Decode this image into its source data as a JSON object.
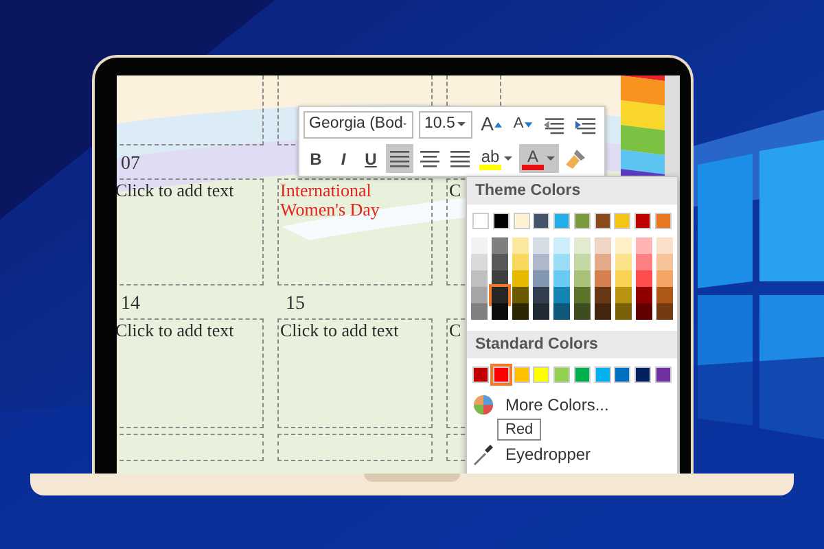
{
  "calendar": {
    "weeks": [
      {
        "days": [
          {
            "number": "07",
            "text": "Click to add text",
            "color": "#2b2b2b"
          },
          {
            "text": "International Women's Day",
            "color": "#e3241d"
          },
          {
            "text": "C",
            "color": "#2b2b2b"
          }
        ]
      },
      {
        "days": [
          {
            "number": "14",
            "text": "Click to add text",
            "color": "#2b2b2b"
          },
          {
            "number": "15",
            "text": "Click to add text",
            "color": "#2b2b2b"
          },
          {
            "text": "C",
            "color": "#2b2b2b"
          }
        ]
      }
    ]
  },
  "mini_toolbar": {
    "font": "Georgia (Bod",
    "size": "10.5",
    "row_1": [
      {
        "kind": "grow",
        "label": "A",
        "selected": false
      },
      {
        "kind": "shrink",
        "label": "A",
        "selected": false
      },
      {
        "kind": "outdent",
        "selected": false
      },
      {
        "kind": "indent",
        "selected": false
      }
    ],
    "row_2": [
      {
        "kind": "bold",
        "label": "B",
        "selected": false
      },
      {
        "kind": "italic",
        "label": "I",
        "selected": false
      },
      {
        "kind": "underline",
        "label": "U",
        "selected": false
      },
      {
        "kind": "align_left",
        "selected": true
      },
      {
        "kind": "align_center",
        "selected": false
      },
      {
        "kind": "align_right",
        "selected": false
      },
      {
        "kind": "highlight",
        "label": "ab",
        "color": "#ffff00",
        "selected": false
      },
      {
        "kind": "font_color",
        "label": "A",
        "color": "#e81010",
        "selected": true
      },
      {
        "kind": "painter",
        "selected": false
      }
    ]
  },
  "color_menu": {
    "theme_title": "Theme Colors",
    "theme_colors": [
      {
        "color": "#ffffff",
        "selected": false
      },
      {
        "color": "#000000",
        "selected": false
      },
      {
        "color": "#fdf3d3",
        "selected": false
      },
      {
        "color": "#44546a",
        "selected": false
      },
      {
        "color": "#22aee6",
        "selected": false
      },
      {
        "color": "#7a9a3a",
        "selected": false
      },
      {
        "color": "#8b4a1a",
        "selected": false
      },
      {
        "color": "#f5c518",
        "selected": false
      },
      {
        "color": "#c00000",
        "selected": false
      },
      {
        "color": "#e87722",
        "selected": false
      }
    ],
    "shades": [
      [
        {
          "color": "#f2f2f2",
          "selected": false
        },
        {
          "color": "#d9d9d9",
          "selected": false
        },
        {
          "color": "#bfbfbf",
          "selected": false
        },
        {
          "color": "#a6a6a6",
          "selected": false
        },
        {
          "color": "#808080",
          "selected": false
        }
      ],
      [
        {
          "color": "#7f7f7f",
          "selected": false
        },
        {
          "color": "#595959",
          "selected": false
        },
        {
          "color": "#3f3f3f",
          "selected": false
        },
        {
          "color": "#262626",
          "selected": true
        },
        {
          "color": "#0d0d0d",
          "selected": false
        }
      ],
      [
        {
          "color": "#fce9a0",
          "selected": false
        },
        {
          "color": "#f9d85f",
          "selected": false
        },
        {
          "color": "#e6b800",
          "selected": false
        },
        {
          "color": "#6b5a00",
          "selected": false
        },
        {
          "color": "#2e2600",
          "selected": false
        }
      ],
      [
        {
          "color": "#d6dce4",
          "selected": false
        },
        {
          "color": "#adb9ca",
          "selected": false
        },
        {
          "color": "#8497b0",
          "selected": false
        },
        {
          "color": "#333f50",
          "selected": false
        },
        {
          "color": "#222a35",
          "selected": false
        }
      ],
      [
        {
          "color": "#cdeefb",
          "selected": false
        },
        {
          "color": "#9bdcf7",
          "selected": false
        },
        {
          "color": "#69cbf3",
          "selected": false
        },
        {
          "color": "#1585b5",
          "selected": false
        },
        {
          "color": "#0e5879",
          "selected": false
        }
      ],
      [
        {
          "color": "#e2ebd2",
          "selected": false
        },
        {
          "color": "#c5d7a5",
          "selected": false
        },
        {
          "color": "#a8c379",
          "selected": false
        },
        {
          "color": "#5c732b",
          "selected": false
        },
        {
          "color": "#3d4d1d",
          "selected": false
        }
      ],
      [
        {
          "color": "#f1d5c4",
          "selected": false
        },
        {
          "color": "#e3ab8a",
          "selected": false
        },
        {
          "color": "#d5814f",
          "selected": false
        },
        {
          "color": "#683714",
          "selected": false
        },
        {
          "color": "#45250d",
          "selected": false
        }
      ],
      [
        {
          "color": "#fdf0c5",
          "selected": false
        },
        {
          "color": "#fbe28b",
          "selected": false
        },
        {
          "color": "#f9d351",
          "selected": false
        },
        {
          "color": "#b8930f",
          "selected": false
        },
        {
          "color": "#7b620a",
          "selected": false
        }
      ],
      [
        {
          "color": "#ffb3b3",
          "selected": false
        },
        {
          "color": "#ff8080",
          "selected": false
        },
        {
          "color": "#ff4d4d",
          "selected": false
        },
        {
          "color": "#900000",
          "selected": false
        },
        {
          "color": "#600000",
          "selected": false
        }
      ],
      [
        {
          "color": "#fbe1cc",
          "selected": false
        },
        {
          "color": "#f7c399",
          "selected": false
        },
        {
          "color": "#f3a566",
          "selected": false
        },
        {
          "color": "#ad5819",
          "selected": false
        },
        {
          "color": "#733b11",
          "selected": false
        }
      ]
    ],
    "standard_title": "Standard Colors",
    "standard_colors": [
      {
        "color": "#c00000",
        "selected": false
      },
      {
        "color": "#ff0000",
        "selected": true
      },
      {
        "color": "#ffc000",
        "selected": false
      },
      {
        "color": "#ffff00",
        "selected": false
      },
      {
        "color": "#92d050",
        "selected": false
      },
      {
        "color": "#00b050",
        "selected": false
      },
      {
        "color": "#00b0f0",
        "selected": false
      },
      {
        "color": "#0070c0",
        "selected": false
      },
      {
        "color": "#002060",
        "selected": false
      },
      {
        "color": "#7030a0",
        "selected": false
      }
    ],
    "items": [
      {
        "kind": "more",
        "label": "More Colors..."
      },
      {
        "kind": "eyedropper",
        "label": "Eyedropper"
      }
    ],
    "tooltip": "Red"
  }
}
